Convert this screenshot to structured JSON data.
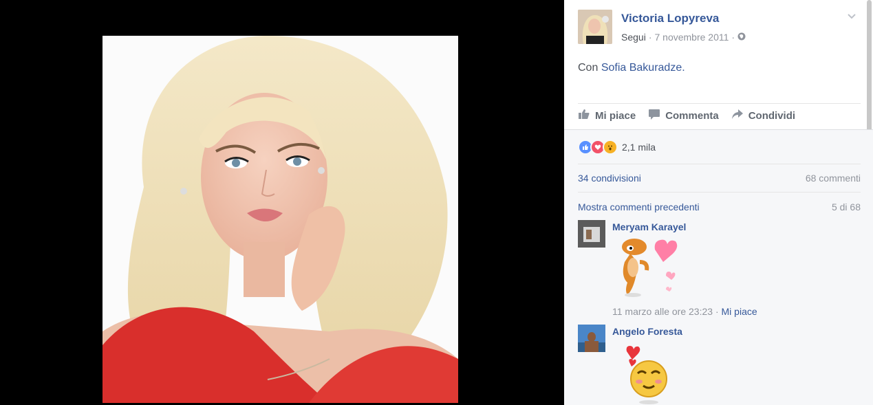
{
  "post": {
    "author": "Victoria Lopyreva",
    "follow_label": "Segui",
    "date": "7 novembre 2011",
    "with_prefix": "Con",
    "tagged_person": "Sofia Bakuradze."
  },
  "actions": {
    "like": "Mi piace",
    "comment": "Commenta",
    "share": "Condividi"
  },
  "reactions": {
    "count": "2,1 mila",
    "types": [
      "like",
      "love",
      "wow"
    ],
    "colors": {
      "like": "#5890ff",
      "love": "#f25268",
      "wow": "#f7b125"
    }
  },
  "stats": {
    "shares": "34 condivisioni",
    "comments": "68 commenti"
  },
  "comments_section": {
    "show_previous": "Mostra commenti precedenti",
    "count": "5 di 68",
    "items": [
      {
        "name": "Meryam Karayel",
        "time": "11 marzo alle ore 23:23",
        "like": "Mi piace",
        "sticker": "dancing-dog-hearts-sticker"
      },
      {
        "name": "Angelo Foresta",
        "sticker": "smiley-with-hearts-sticker"
      }
    ]
  },
  "colors": {
    "link": "#365899",
    "muted": "#90949c",
    "panel_bg": "#f6f7f9"
  }
}
